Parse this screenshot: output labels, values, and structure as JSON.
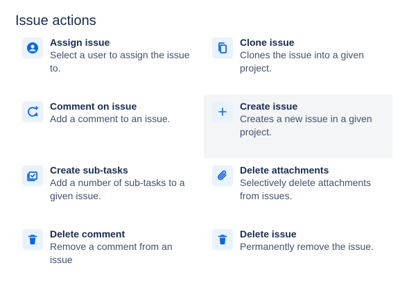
{
  "header": {
    "title": "Issue actions"
  },
  "colors": {
    "icon": "#0c66e4",
    "icon_bg": "#e9f2ff",
    "hover_bg": "#f4f5f7"
  },
  "actions": [
    {
      "title": "Assign issue",
      "description": "Select a user to assign the issue to.",
      "icon": "user-circle-icon"
    },
    {
      "title": "Clone issue",
      "description": "Clones the issue into a given project.",
      "icon": "copy-icon"
    },
    {
      "title": "Comment on issue",
      "description": "Add a comment to an issue.",
      "icon": "comment-add-icon"
    },
    {
      "title": "Create issue",
      "description": "Creates a new issue in a given project.",
      "icon": "plus-icon"
    },
    {
      "title": "Create sub-tasks",
      "description": "Add a number of sub-tasks to a given issue.",
      "icon": "subtask-check-icon"
    },
    {
      "title": "Delete attachments",
      "description": "Selectively delete attachments from issues.",
      "icon": "paperclip-icon"
    },
    {
      "title": "Delete comment",
      "description": "Remove a comment from an issue",
      "icon": "trash-icon"
    },
    {
      "title": "Delete issue",
      "description": "Permanently remove the issue.",
      "icon": "trash-icon"
    }
  ]
}
